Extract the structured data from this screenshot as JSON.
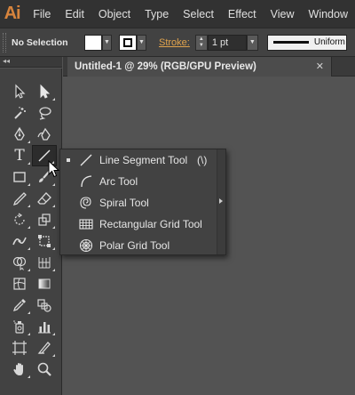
{
  "app": {
    "logo": "Ai",
    "brand_color": "#d7843d"
  },
  "menubar": {
    "items": [
      "File",
      "Edit",
      "Object",
      "Type",
      "Select",
      "Effect",
      "View",
      "Window"
    ]
  },
  "controlbar": {
    "selection_status": "No Selection",
    "stroke_label": "Stroke:",
    "stroke_weight": "1 pt",
    "profile_label": "Uniform",
    "fill_color": "#ffffff",
    "stroke_color": "#000000"
  },
  "document": {
    "tab_title": "Untitled-1 @ 29% (RGB/GPU Preview)",
    "close_glyph": "✕"
  },
  "toolbox": {
    "collapse_glyph": "◂◂",
    "tools": [
      [
        "selection-tool-icon",
        "direct-selection-tool-icon"
      ],
      [
        "magic-wand-tool-icon",
        "lasso-tool-icon"
      ],
      [
        "pen-tool-icon",
        "curvature-tool-icon"
      ],
      [
        "type-tool-icon",
        "line-segment-tool-icon"
      ],
      [
        "rectangle-tool-icon",
        "paintbrush-tool-icon"
      ],
      [
        "pencil-tool-icon",
        "eraser-tool-icon"
      ],
      [
        "rotate-tool-icon",
        "scale-tool-icon"
      ],
      [
        "width-tool-icon",
        "free-transform-tool-icon"
      ],
      [
        "shape-builder-tool-icon",
        "perspective-grid-tool-icon"
      ],
      [
        "mesh-tool-icon",
        "gradient-tool-icon"
      ],
      [
        "eyedropper-tool-icon",
        "blend-tool-icon"
      ],
      [
        "symbol-sprayer-tool-icon",
        "column-graph-tool-icon"
      ],
      [
        "artboard-tool-icon",
        "slice-tool-icon"
      ],
      [
        "hand-tool-icon",
        "zoom-tool-icon"
      ]
    ],
    "type_tool_glyph": "T"
  },
  "flyout": {
    "items": [
      {
        "label": "Line Segment Tool",
        "shortcut": "(\\)",
        "icon": "line-segment-icon",
        "selected": true
      },
      {
        "label": "Arc Tool",
        "shortcut": "",
        "icon": "arc-icon",
        "selected": false
      },
      {
        "label": "Spiral Tool",
        "shortcut": "",
        "icon": "spiral-icon",
        "selected": false
      },
      {
        "label": "Rectangular Grid Tool",
        "shortcut": "",
        "icon": "rectangular-grid-icon",
        "selected": false
      },
      {
        "label": "Polar Grid Tool",
        "shortcut": "",
        "icon": "polar-grid-icon",
        "selected": false
      }
    ]
  }
}
